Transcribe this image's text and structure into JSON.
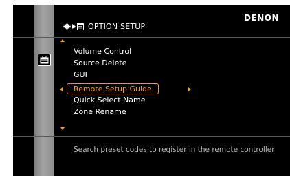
{
  "header": {
    "brand": "DENON",
    "title": "OPTION SETUP",
    "icons": [
      "settings-icon",
      "breadcrumb-arrow-icon",
      "menu-icon"
    ]
  },
  "sidebar": {
    "icon": "briefcase-icon"
  },
  "menu": {
    "items": [
      {
        "label": "Volume Control"
      },
      {
        "label": "Source Delete"
      },
      {
        "label": "GUI"
      },
      {
        "label": "Remote Setup Guide",
        "selected": true
      },
      {
        "label": "Quick Select Name"
      },
      {
        "label": "Zone Rename"
      }
    ]
  },
  "description": "Search preset codes to register in the remote controller",
  "colors": {
    "background": "#000000",
    "accent": "#f39c12",
    "text": "#ffffff",
    "description_text": "#b9b9b9",
    "side_bar": "#8e8e8e"
  }
}
